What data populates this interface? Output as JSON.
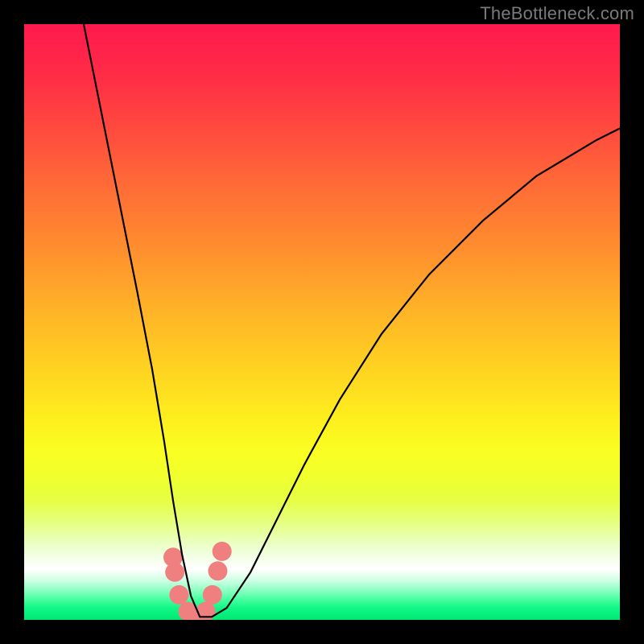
{
  "watermark": {
    "text": "TheBottleneck.com"
  },
  "chart_data": {
    "type": "line",
    "title": "",
    "xlabel": "",
    "ylabel": "",
    "xlim": [
      0,
      100
    ],
    "ylim": [
      0,
      100
    ],
    "grid": false,
    "legend": null,
    "series": [
      {
        "name": "bottleneck-curve",
        "x": [
          10,
          13,
          16,
          19,
          21.5,
          23.5,
          25,
          26.5,
          28,
          29.5,
          31.5,
          34,
          38,
          42,
          47,
          53,
          60,
          68,
          77,
          86,
          96,
          100
        ],
        "y": [
          100,
          85,
          70,
          55,
          42,
          30,
          20,
          11,
          4,
          0.5,
          0.5,
          2,
          8,
          16,
          26,
          37,
          48,
          58,
          67,
          74.5,
          80.5,
          82.5
        ]
      }
    ],
    "markers": {
      "name": "highlight-points",
      "x": [
        25.0,
        25.3,
        26.0,
        27.5,
        29.0,
        30.5,
        31.6,
        32.5,
        33.2
      ],
      "y": [
        10.5,
        8.0,
        4.2,
        1.4,
        0.6,
        1.4,
        4.2,
        8.2,
        11.5
      ],
      "color": "#f08080",
      "radius_px": 12
    },
    "background_gradient": {
      "stops": [
        {
          "pct": 0,
          "hex": "#ff1a4d"
        },
        {
          "pct": 28,
          "hex": "#ff6e36"
        },
        {
          "pct": 58,
          "hex": "#ffd321"
        },
        {
          "pct": 80,
          "hex": "#e6ff44"
        },
        {
          "pct": 91,
          "hex": "#ffffff"
        },
        {
          "pct": 100,
          "hex": "#00e873"
        }
      ]
    }
  }
}
